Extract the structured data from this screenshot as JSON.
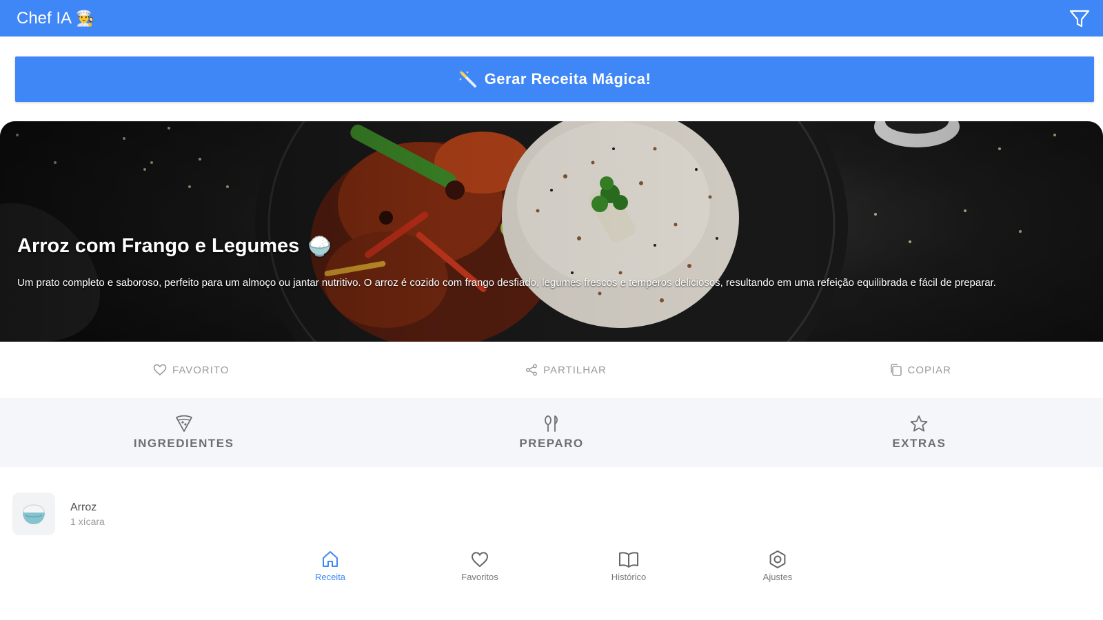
{
  "app": {
    "title": "Chef IA",
    "title_emoji": "👨‍🍳"
  },
  "generate": {
    "label": "Gerar Receita Mágica!"
  },
  "recipe": {
    "title": "Arroz com Frango e Legumes",
    "title_emoji": "🍚",
    "description": "Um prato completo e saboroso, perfeito para um almoço ou jantar nutritivo. O arroz é cozido com frango desfiado, legumes frescos e temperos deliciosos, resultando em uma refeição equilibrada e fácil de preparar."
  },
  "actions": [
    {
      "label": "FAVORITO",
      "icon": "heart-outline-icon"
    },
    {
      "label": "PARTILHAR",
      "icon": "share-icon"
    },
    {
      "label": "COPIAR",
      "icon": "copy-icon"
    }
  ],
  "tabs": [
    {
      "label": "INGREDIENTES",
      "icon": "pizza-slice-icon"
    },
    {
      "label": "PREPARO",
      "icon": "chef-tools-icon"
    },
    {
      "label": "EXTRAS",
      "icon": "star-outline-icon"
    }
  ],
  "ingredients": [
    {
      "name": "Arroz",
      "quantity": "1 xícara",
      "icon": "rice-bowl-icon"
    }
  ],
  "bottom_nav": [
    {
      "label": "Receita",
      "icon": "home-icon",
      "active": true
    },
    {
      "label": "Favoritos",
      "icon": "heart-icon",
      "active": false
    },
    {
      "label": "Histórico",
      "icon": "book-icon",
      "active": false
    },
    {
      "label": "Ajustes",
      "icon": "settings-icon",
      "active": false
    }
  ],
  "colors": {
    "primary": "#3f86f7",
    "tab_background": "#f4f6f9",
    "muted_text": "#9a9a9a"
  }
}
